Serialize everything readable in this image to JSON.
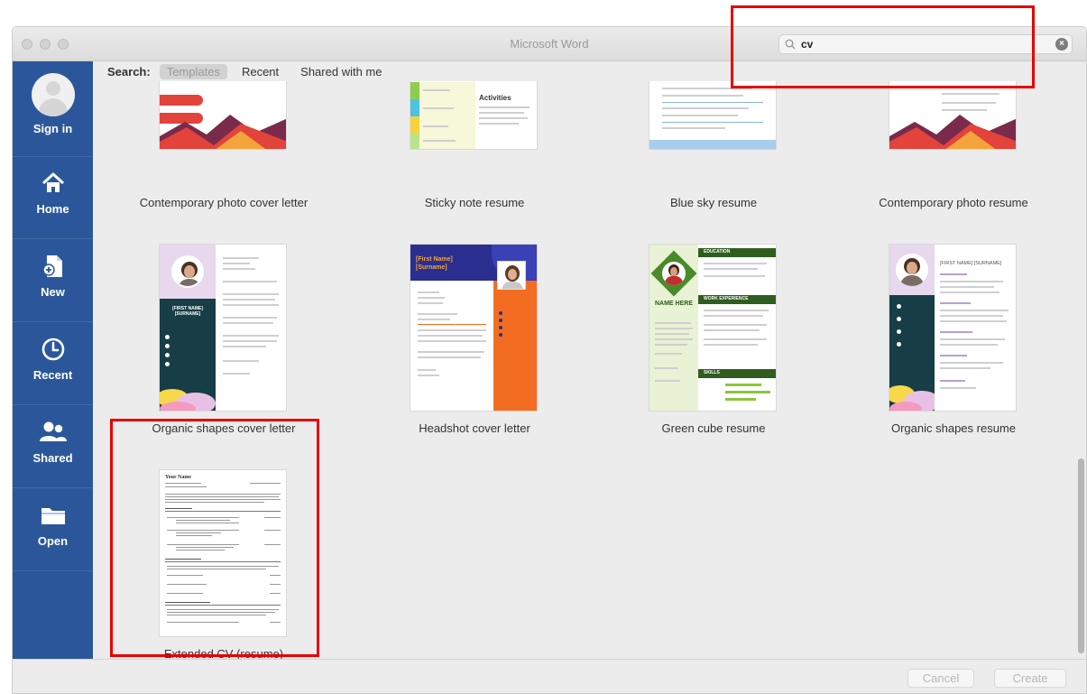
{
  "window": {
    "title": "Microsoft Word"
  },
  "search": {
    "value": "cv",
    "clear_icon": "clear-icon"
  },
  "sidebar": {
    "items": [
      {
        "label": "Sign in",
        "icon": "avatar-icon"
      },
      {
        "label": "Home",
        "icon": "home-icon"
      },
      {
        "label": "New",
        "icon": "new-document-icon"
      },
      {
        "label": "Recent",
        "icon": "clock-icon"
      },
      {
        "label": "Shared",
        "icon": "people-icon"
      },
      {
        "label": "Open",
        "icon": "folder-icon"
      }
    ]
  },
  "filter": {
    "lead": "Search:",
    "tabs": [
      {
        "label": "Templates",
        "active": true
      },
      {
        "label": "Recent",
        "active": false
      },
      {
        "label": "Shared with me",
        "active": false
      }
    ]
  },
  "templates": [
    {
      "label": "Contemporary photo cover letter"
    },
    {
      "label": "Sticky note resume"
    },
    {
      "label": "Blue sky resume"
    },
    {
      "label": "Contemporary photo resume"
    },
    {
      "label": "Organic shapes cover letter",
      "thumb_text": "[FIRST NAME] [SURNAME]"
    },
    {
      "label": "Headshot cover letter",
      "thumb_text": "[First Name] [Surname]"
    },
    {
      "label": "Green cube resume",
      "thumb_text": "NAME HERE",
      "sections": [
        "EDUCATION",
        "WORK EXPERIENCE",
        "SKILLS"
      ]
    },
    {
      "label": "Organic shapes resume",
      "thumb_text": "[FIRST NAME] [SURNAME]"
    },
    {
      "label": "Extended CV (resume)",
      "thumb_text": "Your Name"
    }
  ],
  "sticky_thumb": {
    "heading": "Activities"
  },
  "footer": {
    "cancel": "Cancel",
    "create": "Create"
  },
  "colors": {
    "sidebar": "#2b579a",
    "highlight": "#e60000",
    "contemporary_red": "#e2433a",
    "headshot_orange": "#f26d21",
    "green_cube": "#2f5d1e"
  }
}
